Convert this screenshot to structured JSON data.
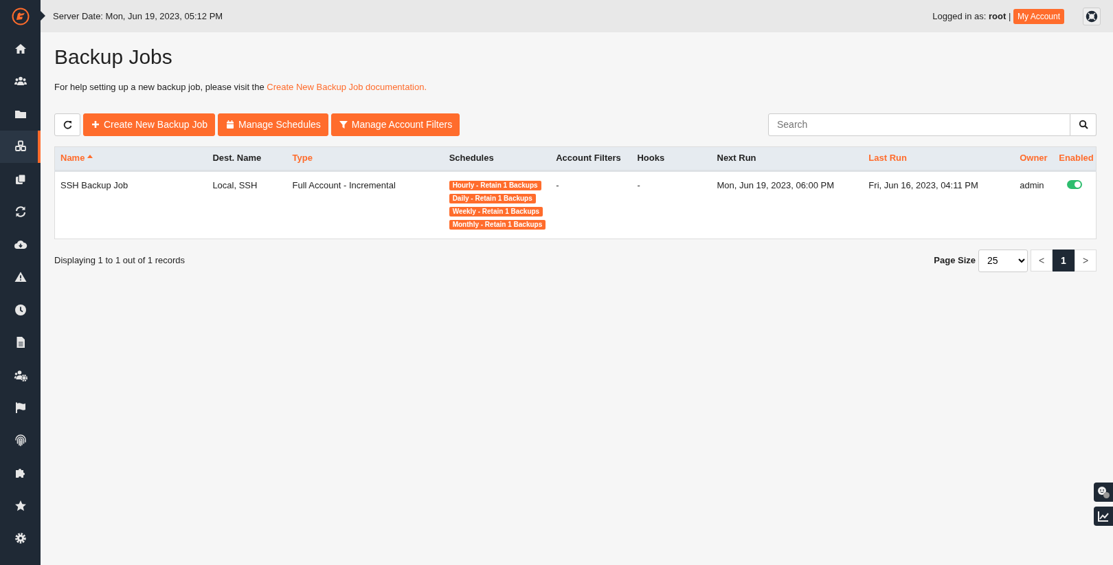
{
  "sidebar": {
    "items": [
      {
        "kind": "home",
        "selected": false
      },
      {
        "kind": "users",
        "selected": false
      },
      {
        "kind": "folder",
        "selected": false
      },
      {
        "kind": "cubes",
        "selected": true
      },
      {
        "kind": "copy",
        "selected": false
      },
      {
        "kind": "sync",
        "selected": false
      },
      {
        "kind": "cloud",
        "selected": false
      },
      {
        "kind": "warning",
        "selected": false
      },
      {
        "kind": "clock",
        "selected": false
      },
      {
        "kind": "file",
        "selected": false
      },
      {
        "kind": "usergear",
        "selected": false
      },
      {
        "kind": "flag",
        "selected": false
      },
      {
        "kind": "fingerprint",
        "selected": false
      },
      {
        "kind": "puzzle",
        "selected": false
      },
      {
        "kind": "star",
        "selected": false
      },
      {
        "kind": "gear",
        "selected": false
      }
    ]
  },
  "header": {
    "server_date": "Server Date: Mon, Jun 19, 2023, 05:12 PM",
    "logged_in_label": "Logged in as:",
    "user": "root",
    "separator": "|",
    "account_button": "My Account"
  },
  "page": {
    "title": "Backup Jobs",
    "help_text": "For help setting up a new backup job, please visit the",
    "help_link": "Create New Backup Job documentation."
  },
  "toolbar": {
    "buttons": [
      {
        "kind": "refresh"
      },
      {
        "kind": "plus",
        "label": "Create New Backup Job"
      },
      {
        "kind": "calendar",
        "label": "Manage Schedules"
      },
      {
        "kind": "filter",
        "label": "Manage Account Filters"
      }
    ],
    "search": {
      "placeholder": "Search"
    }
  },
  "table": {
    "columns": [
      {
        "label": "Name",
        "sortable": true,
        "sorted": true
      },
      {
        "label": "Dest. Name",
        "sortable": false,
        "sorted": false
      },
      {
        "label": "Type",
        "sortable": true,
        "sorted": false
      },
      {
        "label": "Schedules",
        "sortable": false,
        "sorted": false
      },
      {
        "label": "Account Filters",
        "sortable": false,
        "sorted": false
      },
      {
        "label": "Hooks",
        "sortable": false,
        "sorted": false
      },
      {
        "label": "Next Run",
        "sortable": false,
        "sorted": false
      },
      {
        "label": "Last Run",
        "sortable": true,
        "sorted": false
      },
      {
        "label": "Owner",
        "sortable": true,
        "sorted": false
      },
      {
        "label": "Enabled",
        "sortable": true,
        "sorted": false
      }
    ],
    "rows": [
      {
        "name": "SSH Backup Job",
        "dest": "Local, SSH",
        "type": "Full Account - Incremental",
        "schedules": [
          "Hourly - Retain 1 Backups",
          "Daily - Retain 1 Backups",
          "Weekly - Retain 1 Backups",
          "Monthly - Retain 1 Backups"
        ],
        "account_filters": "-",
        "hooks": "-",
        "next_run": "Mon, Jun 19, 2023, 06:00 PM",
        "last_run": "Fri, Jun 16, 2023, 04:11 PM",
        "owner": "admin",
        "enabled": true
      }
    ]
  },
  "footer": {
    "records": "Displaying 1 to 1 out of 1 records",
    "page_size_label": "Page Size",
    "page_size": "25",
    "pages": [
      {
        "label": "<",
        "selected": false
      },
      {
        "label": "1",
        "selected": true
      },
      {
        "label": ">",
        "selected": false
      }
    ]
  }
}
